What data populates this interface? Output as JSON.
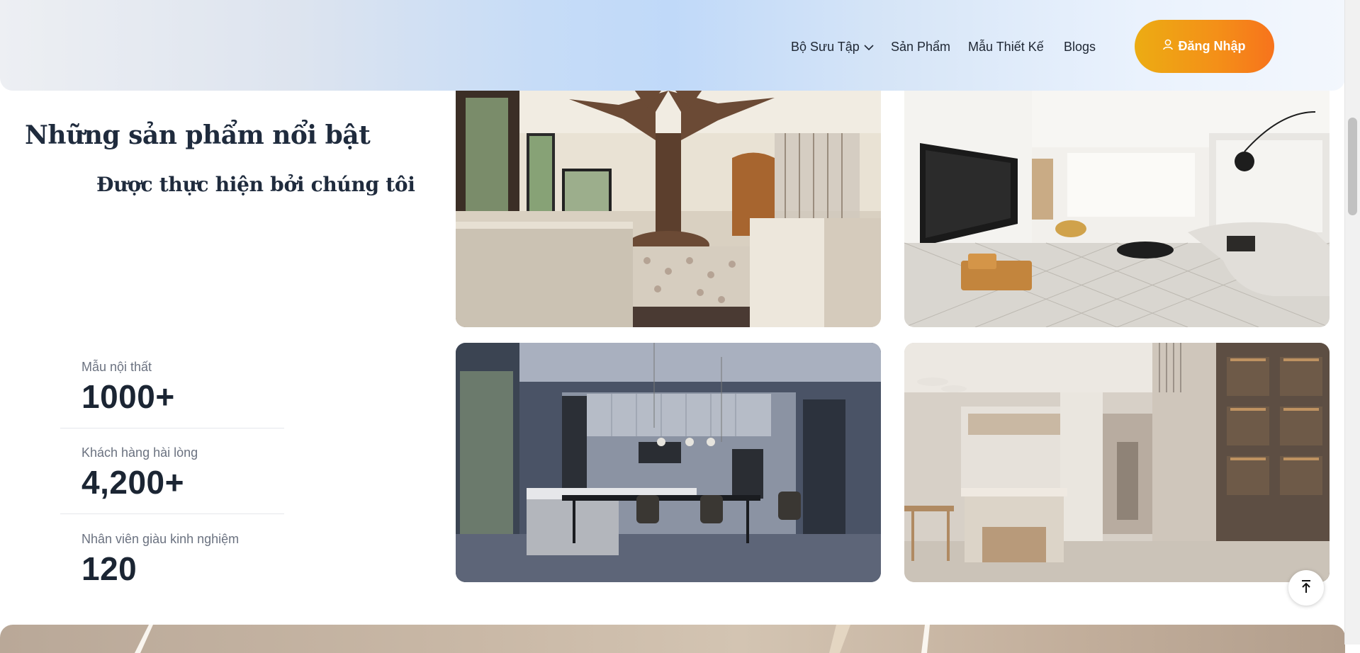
{
  "header": {
    "nav": [
      {
        "label": "Bộ Sưu Tập",
        "has_dropdown": true
      },
      {
        "label": "Sản Phẩm"
      },
      {
        "label": "Mẫu Thiết Kế"
      },
      {
        "label": "Blogs"
      }
    ],
    "login_label": "Đăng Nhập",
    "login_icon": "user-icon"
  },
  "featured": {
    "title": "Những sản phẩm nổi bật",
    "subtitle": "Được thực hiện bởi chúng tôi"
  },
  "stats": [
    {
      "label": "Mẫu nội thất",
      "value": "1000+"
    },
    {
      "label": "Khách hàng hài lòng",
      "value": "4,200+"
    },
    {
      "label": "Nhân viên giàu kinh nghiệm",
      "value": "120"
    }
  ],
  "gallery": [
    {
      "name": "lobby-tree-column-photo"
    },
    {
      "name": "living-room-tv-wall-photo"
    },
    {
      "name": "dark-kitchen-dining-photo"
    },
    {
      "name": "beige-kitchen-hallway-photo"
    }
  ],
  "scroll_top_icon": "arrow-up-to-line-icon",
  "colors": {
    "accent_start": "#ecac13",
    "accent_end": "#f7731c",
    "heading": "#1f2b3d",
    "muted": "#6b7280"
  }
}
